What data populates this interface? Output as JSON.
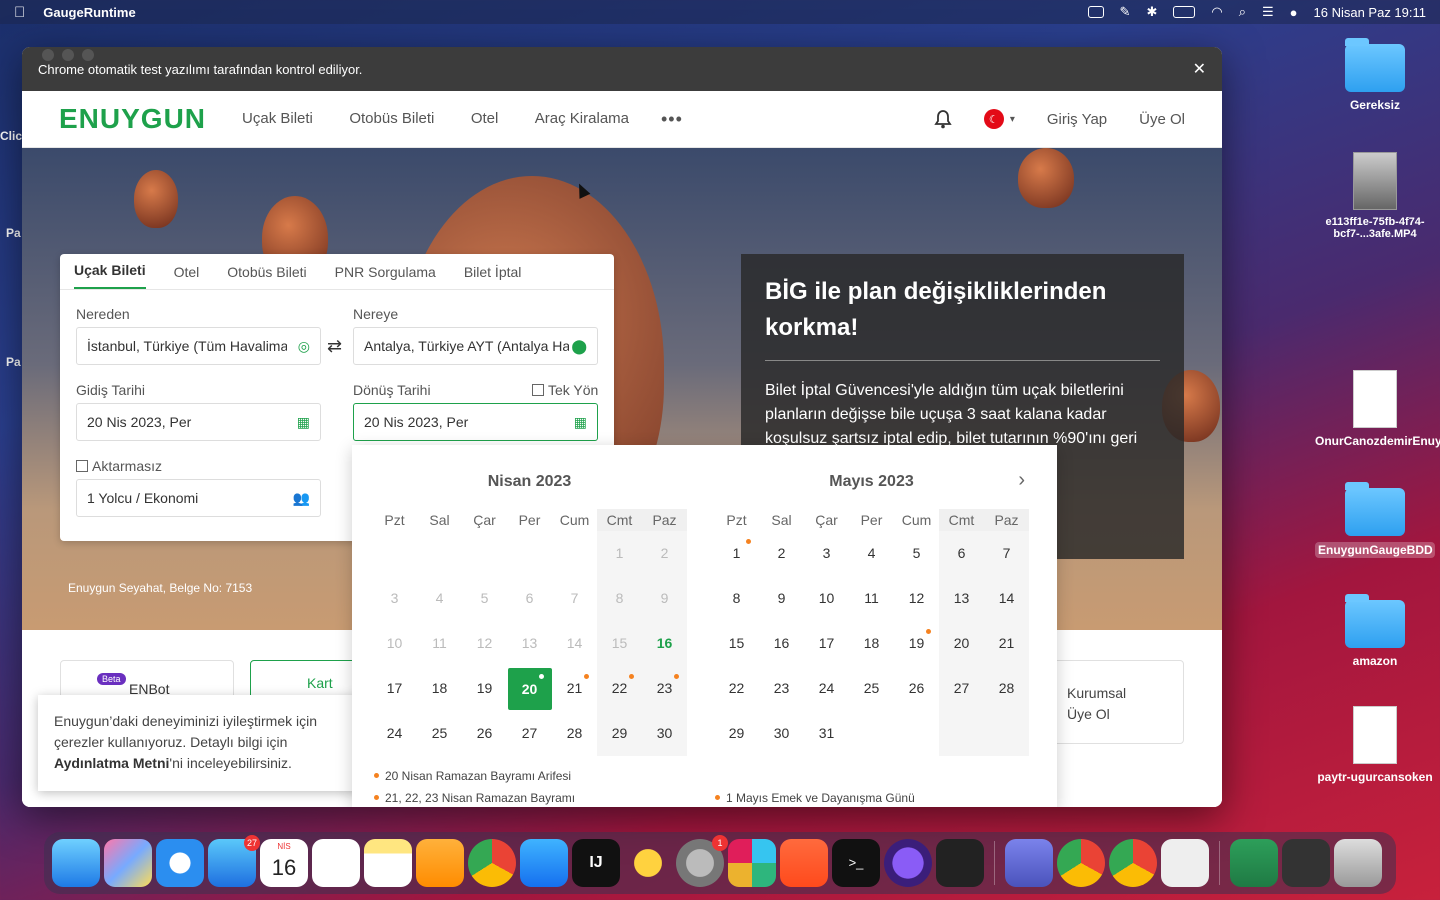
{
  "menubar": {
    "app_name": "GaugeRuntime",
    "datetime": "16 Nisan Paz  19:11"
  },
  "desktop": {
    "icons": [
      {
        "label": "Gereksiz"
      },
      {
        "label": "e113ff1e-75fb-4f74-bcf7-...3afe.MP4"
      },
      {
        "label": "OnurCanozdemirEnuygun"
      },
      {
        "label": "EnuygunGaugeBDD"
      },
      {
        "label": "amazon"
      },
      {
        "label": "paytr-ugurcansoken"
      }
    ],
    "left_partial": [
      "Clic",
      "Pa",
      "Pa"
    ]
  },
  "browser": {
    "automation_notice": "Chrome otomatik test yazılımı tarafından kontrol ediliyor.",
    "close_glyph": "✕"
  },
  "header": {
    "logo": "ENUYGUN",
    "nav": [
      "Uçak Bileti",
      "Otobüs Bileti",
      "Otel",
      "Araç Kiralama"
    ],
    "more": "•••",
    "login": "Giriş Yap",
    "signup": "Üye Ol"
  },
  "search": {
    "tabs": [
      "Uçak Bileti",
      "Otel",
      "Otobüs Bileti",
      "PNR Sorgulama",
      "Bilet İptal"
    ],
    "from_label": "Nereden",
    "from_value": "İstanbul, Türkiye (Tüm Havalimanları)",
    "to_label": "Nereye",
    "to_value": "Antalya, Türkiye AYT (Antalya Havalimanı)",
    "depart_label": "Gidiş Tarihi",
    "depart_value": "20 Nis 2023, Per",
    "return_label": "Dönüş Tarihi",
    "return_value": "20 Nis 2023, Per",
    "oneway_label": "Tek Yön",
    "direct_label": "Aktarmasız",
    "passenger_value": "1 Yolcu / Ekonomi",
    "swap_glyph": "⇄"
  },
  "promo": {
    "title": "BİG ile plan değişikliklerinden korkma!",
    "body": "Bilet İptal Güvencesi'yle aldığın tüm uçak biletlerini planların değişse bile uçuşa 3 saat kalana kadar koşulsuz şartsız iptal edip, bilet tutarının %90'ını geri"
  },
  "belge": "Enuygun Seyahat, Belge No: 7153",
  "bottom": {
    "enbot": "ENBot",
    "beta": "Beta",
    "kart": "Kart",
    "kurumsal_line1": "Kurumsal",
    "kurumsal_line2": "Üye Ol"
  },
  "cookie": {
    "line1": "Enuygun’daki deneyiminizi iyileştirmek için",
    "line2": "çerezler kullanıyoruz. Detaylı bilgi için",
    "link": "Aydınlatma Metni",
    "line3_rest": "'ni inceleyebilirsiniz."
  },
  "calendar": {
    "weekdays": [
      "Pzt",
      "Sal",
      "Çar",
      "Per",
      "Cum",
      "Cmt",
      "Paz"
    ],
    "months": [
      {
        "title": "Nisan 2023",
        "leading_blanks": 5,
        "days": 30,
        "disabled_until": 15,
        "today": 16,
        "selected": 20,
        "holidays": [
          20,
          21,
          22,
          23
        ]
      },
      {
        "title": "Mayıs 2023",
        "leading_blanks": 0,
        "days": 31,
        "disabled_until": 0,
        "today": 0,
        "selected": 0,
        "holidays": [
          1,
          19
        ]
      }
    ],
    "next_glyph": "›",
    "legend": [
      "20 Nisan Ramazan Bayramı Arifesi",
      "21, 22, 23 Nisan Ramazan Bayramı",
      "1 Mayıs Emek ve Dayanışma Günü"
    ]
  },
  "dock": {
    "mail_badge": "27",
    "settings_badge": "1",
    "calendar_month": "NİS",
    "calendar_day": "16",
    "intellij_label": "IJ",
    "terminal_label": ">_"
  },
  "colors": {
    "brand_green": "#1ea14b",
    "holiday_orange": "#f58220"
  }
}
